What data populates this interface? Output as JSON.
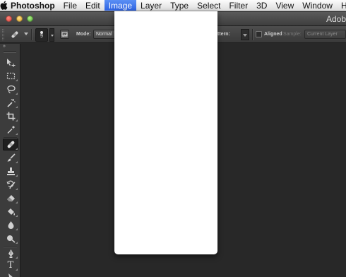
{
  "menubar": {
    "app_name": "Photoshop",
    "items": [
      {
        "label": "File"
      },
      {
        "label": "Edit"
      },
      {
        "label": "Image",
        "active": true
      },
      {
        "label": "Layer"
      },
      {
        "label": "Type"
      },
      {
        "label": "Select"
      },
      {
        "label": "Filter"
      },
      {
        "label": "3D"
      },
      {
        "label": "View"
      },
      {
        "label": "Window"
      },
      {
        "label": "He"
      }
    ]
  },
  "titlebar": {
    "title": "Adob"
  },
  "options": {
    "brush_size": "9",
    "mode_label": "Mode:",
    "mode_value": "Normal",
    "pattern_label": "ttern:",
    "aligned_label": "Aligned",
    "aligned_checked": false,
    "sample_label": "Sample:",
    "sample_value": "Current Layer"
  },
  "toolbar": {
    "collapse_glyph": "»",
    "selected_tool": "healing-brush",
    "tools": [
      {
        "name": "move-tool",
        "icon": "move-icon"
      },
      {
        "name": "marquee-tool",
        "icon": "marquee-icon"
      },
      {
        "name": "lasso-tool",
        "icon": "lasso-icon"
      },
      {
        "name": "magic-wand-tool",
        "icon": "magic-wand-icon"
      },
      {
        "name": "crop-tool",
        "icon": "crop-icon"
      },
      {
        "name": "eyedropper-tool",
        "icon": "eyedropper-icon"
      },
      {
        "name": "healing-brush-tool",
        "icon": "bandage-icon"
      },
      {
        "name": "brush-tool",
        "icon": "brush-icon"
      },
      {
        "name": "clone-stamp-tool",
        "icon": "stamp-icon"
      },
      {
        "name": "history-brush-tool",
        "icon": "history-brush-icon"
      },
      {
        "name": "eraser-tool",
        "icon": "eraser-icon"
      },
      {
        "name": "paint-bucket-tool",
        "icon": "paint-bucket-icon"
      },
      {
        "name": "blur-tool",
        "icon": "blur-drop-icon"
      },
      {
        "name": "dodge-tool",
        "icon": "dodge-icon"
      },
      {
        "name": "pen-tool",
        "icon": "pen-icon"
      },
      {
        "name": "type-tool",
        "icon": "type-icon",
        "glyph": "T"
      },
      {
        "name": "path-selection-tool",
        "icon": "path-selection-icon"
      }
    ]
  },
  "colors": {
    "menu_highlight": "#3a6cec",
    "workspace": "#282828",
    "panel": "#3c3c3c"
  }
}
